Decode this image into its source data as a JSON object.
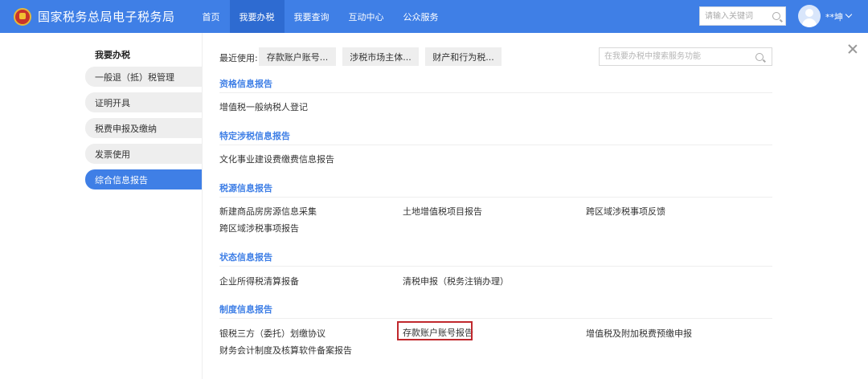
{
  "header": {
    "site_title": "国家税务总局电子税务局",
    "nav": [
      "首页",
      "我要办税",
      "我要查询",
      "互动中心",
      "公众服务"
    ],
    "search_placeholder": "请输入关键词",
    "user_name": "**坤"
  },
  "sidebar": {
    "title": "我要办税",
    "items": [
      "一般退（抵）税管理",
      "证明开具",
      "税费申报及缴纳",
      "发票使用",
      "综合信息报告"
    ]
  },
  "main": {
    "recent_label": "最近使用:",
    "recent_items": [
      "存款账户账号...",
      "涉税市场主体...",
      "财产和行为税..."
    ],
    "search_placeholder": "在我要办税中搜索服务功能",
    "sections": [
      {
        "title": "资格信息报告",
        "links": [
          "增值税一般纳税人登记"
        ]
      },
      {
        "title": "特定涉税信息报告",
        "links": [
          "文化事业建设费缴费信息报告"
        ]
      },
      {
        "title": "税源信息报告",
        "links": [
          "新建商品房房源信息采集",
          "土地增值税项目报告",
          "跨区域涉税事项反馈",
          "跨区域涉税事项报告"
        ]
      },
      {
        "title": "状态信息报告",
        "links": [
          "企业所得税清算报备",
          "清税申报（税务注销办理）"
        ]
      },
      {
        "title": "制度信息报告",
        "links": [
          "银税三方（委托）划缴协议",
          "存款账户账号报告",
          "增值税及附加税费预缴申报",
          "财务会计制度及核算软件备案报告"
        ]
      }
    ]
  },
  "colors": {
    "accent": "#3f7fe6",
    "highlight": "#c0282d"
  }
}
